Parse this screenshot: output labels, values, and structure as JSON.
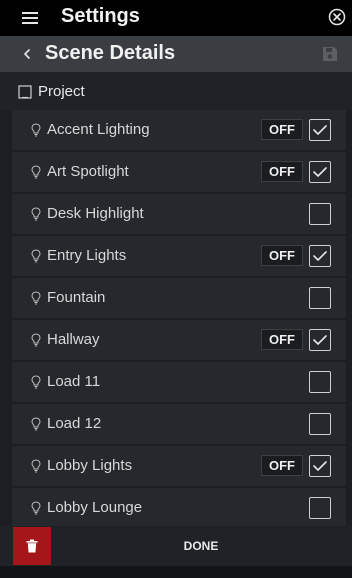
{
  "app_bar": {
    "title": "Settings",
    "menu_icon": "hamburger-menu-icon",
    "close_icon": "close-circle-icon"
  },
  "sub_header": {
    "title": "Scene Details",
    "back_icon": "chevron-left-icon",
    "save_icon": "floppy-disk-icon"
  },
  "project": {
    "label": "Project",
    "checked": false
  },
  "loads": [
    {
      "name": "Accent Lighting",
      "state": "OFF",
      "checked": true
    },
    {
      "name": "Art Spotlight",
      "state": "OFF",
      "checked": true
    },
    {
      "name": "Desk Highlight",
      "state": "",
      "checked": false
    },
    {
      "name": "Entry Lights",
      "state": "OFF",
      "checked": true
    },
    {
      "name": "Fountain",
      "state": "",
      "checked": false
    },
    {
      "name": "Hallway",
      "state": "OFF",
      "checked": true
    },
    {
      "name": "Load 11",
      "state": "",
      "checked": false
    },
    {
      "name": "Load 12",
      "state": "",
      "checked": false
    },
    {
      "name": "Lobby Lights",
      "state": "OFF",
      "checked": true
    },
    {
      "name": "Lobby Lounge",
      "state": "",
      "checked": false
    }
  ],
  "footer": {
    "done_label": "DONE",
    "delete_icon": "trash-icon"
  },
  "colors": {
    "app_bar_bg": "#000000",
    "sub_header_bg": "#3a3d42",
    "row_bg": "#25282d",
    "delete_bg": "#a5161a"
  }
}
